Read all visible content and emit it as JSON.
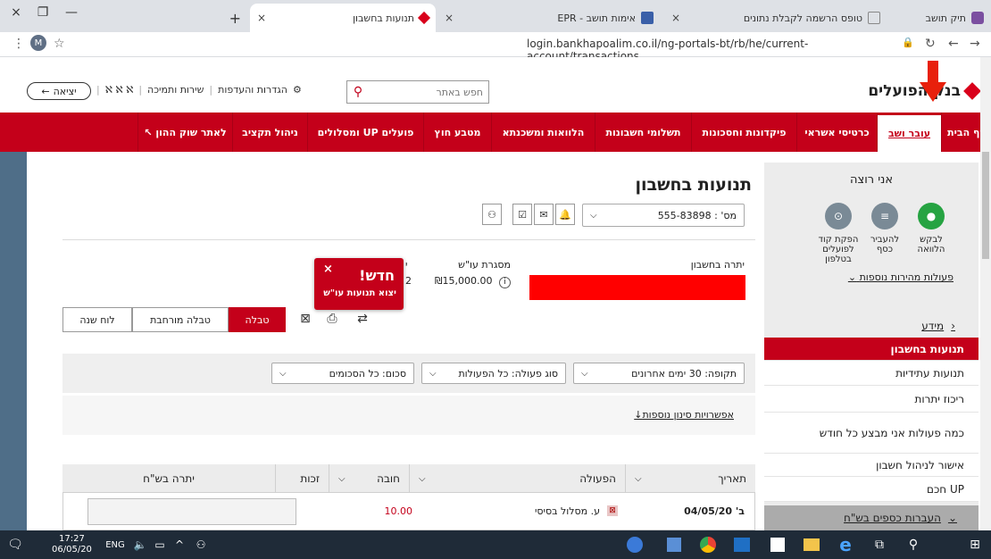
{
  "browser": {
    "tabs": [
      {
        "title": "תיק תושב",
        "close": "×"
      },
      {
        "title": "טופס הרשמה לקבלת נתונים",
        "close": "×"
      },
      {
        "title": "אימות תושב - EPR",
        "close": "×"
      },
      {
        "title": "תנועות בחשבון",
        "close": "×"
      }
    ],
    "new_tab": "+",
    "url": "login.bankhapoalim.co.il/ng-portals-bt/rb/he/current-account/transactions",
    "avatar": "M"
  },
  "header": {
    "logo_text": "בנק הפועלים",
    "search_placeholder": "חפש באתר",
    "settings": "הגדרות והעדפות",
    "support": "שירות ותמיכה",
    "font_sizes": "ℵ ℵ ℵ",
    "logout": "יציאה"
  },
  "nav": {
    "items": [
      {
        "label": "דף הבית",
        "w": 56
      },
      {
        "label": "עובר ושב",
        "w": 72,
        "active": true
      },
      {
        "label": "כרטיסי אשראי",
        "w": 90
      },
      {
        "label": "פיקדונות וחסכונות",
        "w": 118
      },
      {
        "label": "תשלומי חשבונות",
        "w": 108
      },
      {
        "label": "הלוואות ומשכנתא",
        "w": 116
      },
      {
        "label": "מטבע חוץ",
        "w": 76
      },
      {
        "label": "פועלים UP ומסלולים",
        "w": 130
      },
      {
        "label": "ניהול תקציב",
        "w": 84
      },
      {
        "label": "לאתר שוק ההון ↖",
        "w": 106
      }
    ]
  },
  "sidebar": {
    "want_title": "אני רוצה",
    "quick_actions": [
      {
        "label": "לבקש הלוואה",
        "color": "#26a342",
        "icon": "●"
      },
      {
        "label": "להעביר כסף",
        "color": "#7a8a96",
        "icon": "≡"
      },
      {
        "label": "הפקת קוד לפועלים בטלפון",
        "color": "#7a8a96",
        "icon": "⊙"
      }
    ],
    "more_quick": "פעולות מהירות נוספות",
    "info_head": "מידע",
    "links": [
      {
        "label": "תנועות בחשבון",
        "active": true
      },
      {
        "label": "תנועות עתידיות"
      },
      {
        "label": "ריכוז יתרות"
      },
      {
        "label": "כמה פעולות אני מבצע כל חודש"
      },
      {
        "label": "אישור לניהול חשבון"
      },
      {
        "label": "UP חכם"
      }
    ],
    "foot": "העברות כספים בש\"ח"
  },
  "main": {
    "title": "תנועות בחשבון",
    "account": "מס' : 555-83898",
    "balance_label": "יתרה בחשבון",
    "frame_label": "מסגרת עו\"ש",
    "frame_value": "₪15,000.00",
    "partial_a": "י",
    "partial_b": "2",
    "popup": {
      "title": "חדש!",
      "subtitle": "יצוא תנועות עו\"ש",
      "close": "×"
    },
    "view_tabs": [
      "טבלה",
      "טבלה מורחבת",
      "לוח שנה"
    ],
    "filters": {
      "period": "תקופה: 30 ימים אחרונים",
      "type": "סוג פעולה: כל הפעולות",
      "amount": "סכום: כל הסכומים"
    },
    "advanced": "אפשרויות סינון נוספות",
    "table": {
      "headers": [
        "תאריך",
        "הפעולה",
        "חובה",
        "זכות",
        "יתרה בש\"ח"
      ],
      "rows": [
        {
          "date": "ב' 04/05/20",
          "action": "ע. מסלול בסיסי",
          "debit": "10.00",
          "credit": "",
          "balance": ""
        }
      ]
    },
    "colors": {
      "brand": "#c4001a",
      "debit": "#c4001a"
    }
  },
  "taskbar": {
    "time": "17:27",
    "date": "06/05/20",
    "lang": "ENG"
  }
}
